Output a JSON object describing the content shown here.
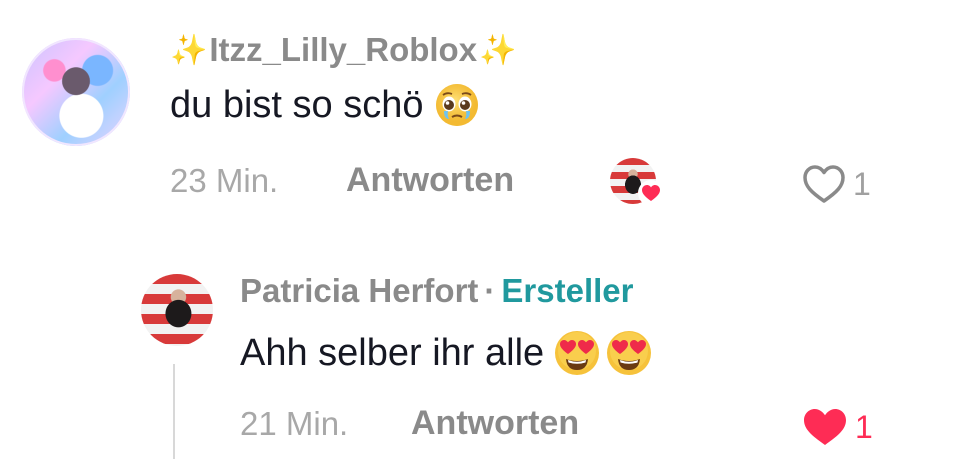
{
  "comments": [
    {
      "username": "Itzz_Lilly_Roblox",
      "sparkle_left": "✨",
      "sparkle_right": "✨",
      "text": "du bist so schö",
      "emoji": "pleading-face",
      "time": "23 Min.",
      "reply_label": "Antworten",
      "like_count": "1",
      "liked": false,
      "creator_liked": true
    },
    {
      "username": "Patricia Herfort",
      "separator": "·",
      "badge": "Ersteller",
      "text": "Ahh selber ihr alle",
      "emojis": [
        "heart-eyes-face",
        "heart-eyes-face"
      ],
      "time": "21 Min.",
      "reply_label": "Antworten",
      "like_count": "1",
      "liked": true
    }
  ],
  "colors": {
    "like_red": "#fe2c55",
    "creator_teal": "#20999e",
    "meta_gray": "#a8a8a8",
    "text_dark": "#161823"
  }
}
